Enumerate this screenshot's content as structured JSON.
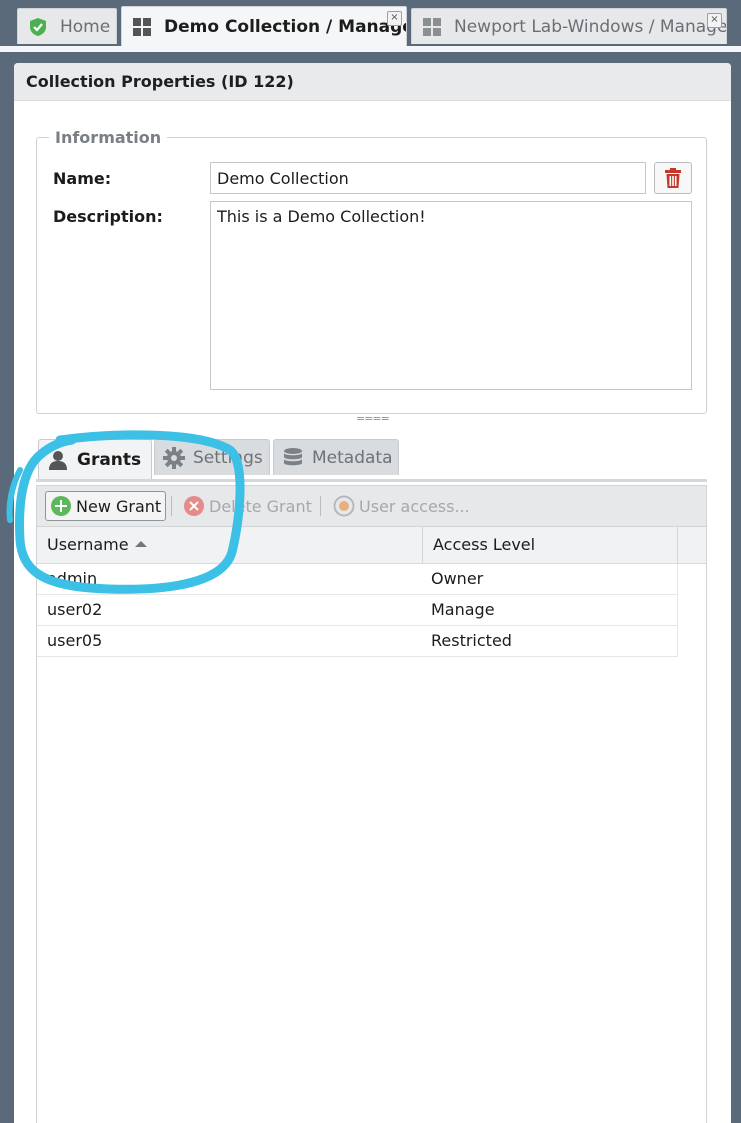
{
  "tabs": [
    {
      "label": "Home",
      "icon": "check-shield-icon",
      "closable": false,
      "active": false
    },
    {
      "label": "Demo Collection / Manage",
      "icon": "grid-icon",
      "closable": true,
      "active": true
    },
    {
      "label": "Newport Lab-Windows / Manage",
      "icon": "grid-icon",
      "closable": true,
      "active": false
    }
  ],
  "tab_close_glyph": "×",
  "panel": {
    "title": "Collection Properties (ID 122)"
  },
  "information": {
    "legend": "Information",
    "name_label": "Name:",
    "name_value": "Demo Collection",
    "description_label": "Description:",
    "description_value": "This is a Demo Collection!",
    "delete_icon": "trash-icon"
  },
  "splitter_glyph": "====",
  "subtabs": [
    {
      "label": "Grants",
      "icon": "user-icon",
      "active": true
    },
    {
      "label": "Settings",
      "icon": "gear-icon",
      "active": false
    },
    {
      "label": "Metadata",
      "icon": "database-icon",
      "active": false
    }
  ],
  "toolbar": {
    "new_grant": "New Grant",
    "delete_grant": "Delete Grant",
    "user_access": "User access..."
  },
  "table": {
    "columns": [
      "Username",
      "Access Level"
    ],
    "sort": {
      "column": "Username",
      "direction": "ascending"
    },
    "rows": [
      {
        "username": "admin",
        "access": "Owner"
      },
      {
        "username": "user02",
        "access": "Manage"
      },
      {
        "username": "user05",
        "access": "Restricted"
      }
    ]
  },
  "colors": {
    "background": "#5b6a7a",
    "annotation_stroke": "#3cc0e6",
    "trash_red": "#c0392b",
    "add_green": "#5cb85c",
    "delete_red": "#e06666",
    "user_access_orange": "#e0a060"
  }
}
